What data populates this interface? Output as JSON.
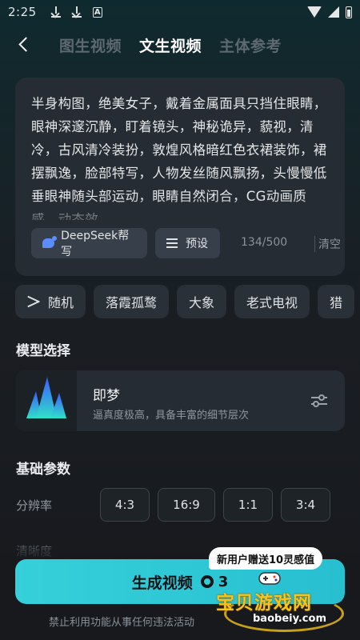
{
  "status_bar": {
    "time": "2:25"
  },
  "header": {
    "tabs": [
      {
        "label": "图生视频",
        "active": false
      },
      {
        "label": "文生视频",
        "active": true
      },
      {
        "label": "主体参考",
        "active": false
      }
    ]
  },
  "prompt": {
    "text": "半身构图，绝美女子，戴着金属面具只挡住眼睛，眼神深邃沉静，盯着镜头，神秘诡异，藐视，清冷，古风清冷装扮，敦煌风格暗红色衣裙装饰，裙摆飘逸，脸部特写，人物发丝随风飘扬，头慢慢低垂眼神随头部运动，眼睛自然闭合，CG动画质感，动态效",
    "deepseek_label": "DeepSeek帮写",
    "preset_label": "预设",
    "counter": "134/500",
    "clear_label": "清空"
  },
  "chips": {
    "random_label": "随机",
    "items": [
      "落霞孤鹜",
      "大象",
      "老式电视",
      "猎"
    ]
  },
  "model": {
    "section_title": "模型选择",
    "name": "即梦",
    "desc": "逼真度极高，具备丰富的细节层次"
  },
  "params": {
    "section_title": "基础参数",
    "resolution_label": "分辨率",
    "ratios": [
      "4:3",
      "16:9",
      "1:1",
      "3:4"
    ],
    "second_label": "清晰度"
  },
  "generate": {
    "label": "生成视频",
    "cost": "3",
    "promo": "新用户赠送10灵感值"
  },
  "disclaimer": "禁止利用功能从事任何违法活动",
  "watermark": {
    "title": "宝贝游戏网",
    "url": "baobeiy.com"
  },
  "colors": {
    "accent": "#33cdd8",
    "background": "#17191d",
    "card": "#262c33"
  }
}
